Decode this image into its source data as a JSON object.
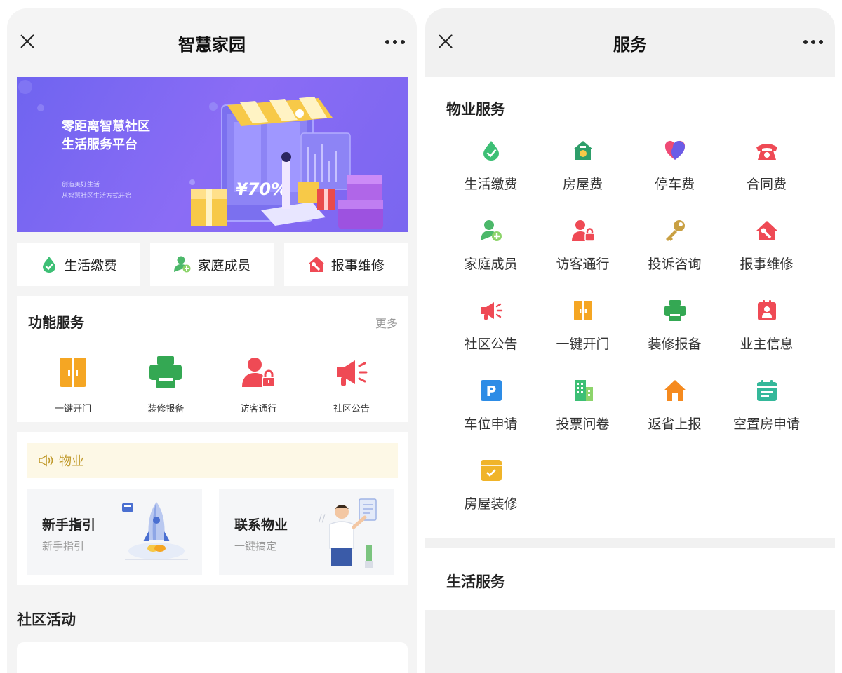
{
  "left": {
    "nav": {
      "title": "智慧家园"
    },
    "banner": {
      "title_line1": "零距离智慧社区",
      "title_line2": "生活服务平台",
      "sub_line1": "创造美好生活",
      "sub_line2": "从智慧社区生活方式开始",
      "sign_text": "¥70%"
    },
    "quick": [
      {
        "label": "生活缴费",
        "icon": "leaf-drop-icon"
      },
      {
        "label": "家庭成员",
        "icon": "user-plus-icon"
      },
      {
        "label": "报事维修",
        "icon": "house-wrench-icon"
      }
    ],
    "functions": {
      "title": "功能服务",
      "more": "更多",
      "items": [
        {
          "label": "一键开门",
          "icon": "door-icon"
        },
        {
          "label": "装修报备",
          "icon": "printer-icon"
        },
        {
          "label": "访客通行",
          "icon": "visitor-lock-icon"
        },
        {
          "label": "社区公告",
          "icon": "megaphone-icon"
        }
      ]
    },
    "property": {
      "notice": "物业",
      "cards": [
        {
          "title": "新手指引",
          "subtitle": "新手指引"
        },
        {
          "title": "联系物业",
          "subtitle": "一键搞定"
        }
      ]
    },
    "activity_title": "社区活动"
  },
  "right": {
    "nav": {
      "title": "服务"
    },
    "property_services": {
      "title": "物业服务",
      "items": [
        {
          "label": "生活缴费",
          "icon": "leaf-drop-icon"
        },
        {
          "label": "房屋费",
          "icon": "house-fee-icon"
        },
        {
          "label": "停车费",
          "icon": "heart-icon"
        },
        {
          "label": "合同费",
          "icon": "telephone-icon"
        },
        {
          "label": "家庭成员",
          "icon": "user-plus-icon"
        },
        {
          "label": "访客通行",
          "icon": "visitor-lock-icon"
        },
        {
          "label": "投诉咨询",
          "icon": "key-icon"
        },
        {
          "label": "报事维修",
          "icon": "house-wrench-icon"
        },
        {
          "label": "社区公告",
          "icon": "megaphone-icon"
        },
        {
          "label": "一键开门",
          "icon": "door-icon"
        },
        {
          "label": "装修报备",
          "icon": "printer-icon"
        },
        {
          "label": "业主信息",
          "icon": "id-card-icon"
        },
        {
          "label": "车位申请",
          "icon": "parking-icon"
        },
        {
          "label": "投票问卷",
          "icon": "building-icon"
        },
        {
          "label": "返省上报",
          "icon": "home-icon"
        },
        {
          "label": "空置房申请",
          "icon": "calendar-icon"
        },
        {
          "label": "房屋装修",
          "icon": "box-check-icon"
        }
      ]
    },
    "life_services": {
      "title": "生活服务"
    }
  }
}
